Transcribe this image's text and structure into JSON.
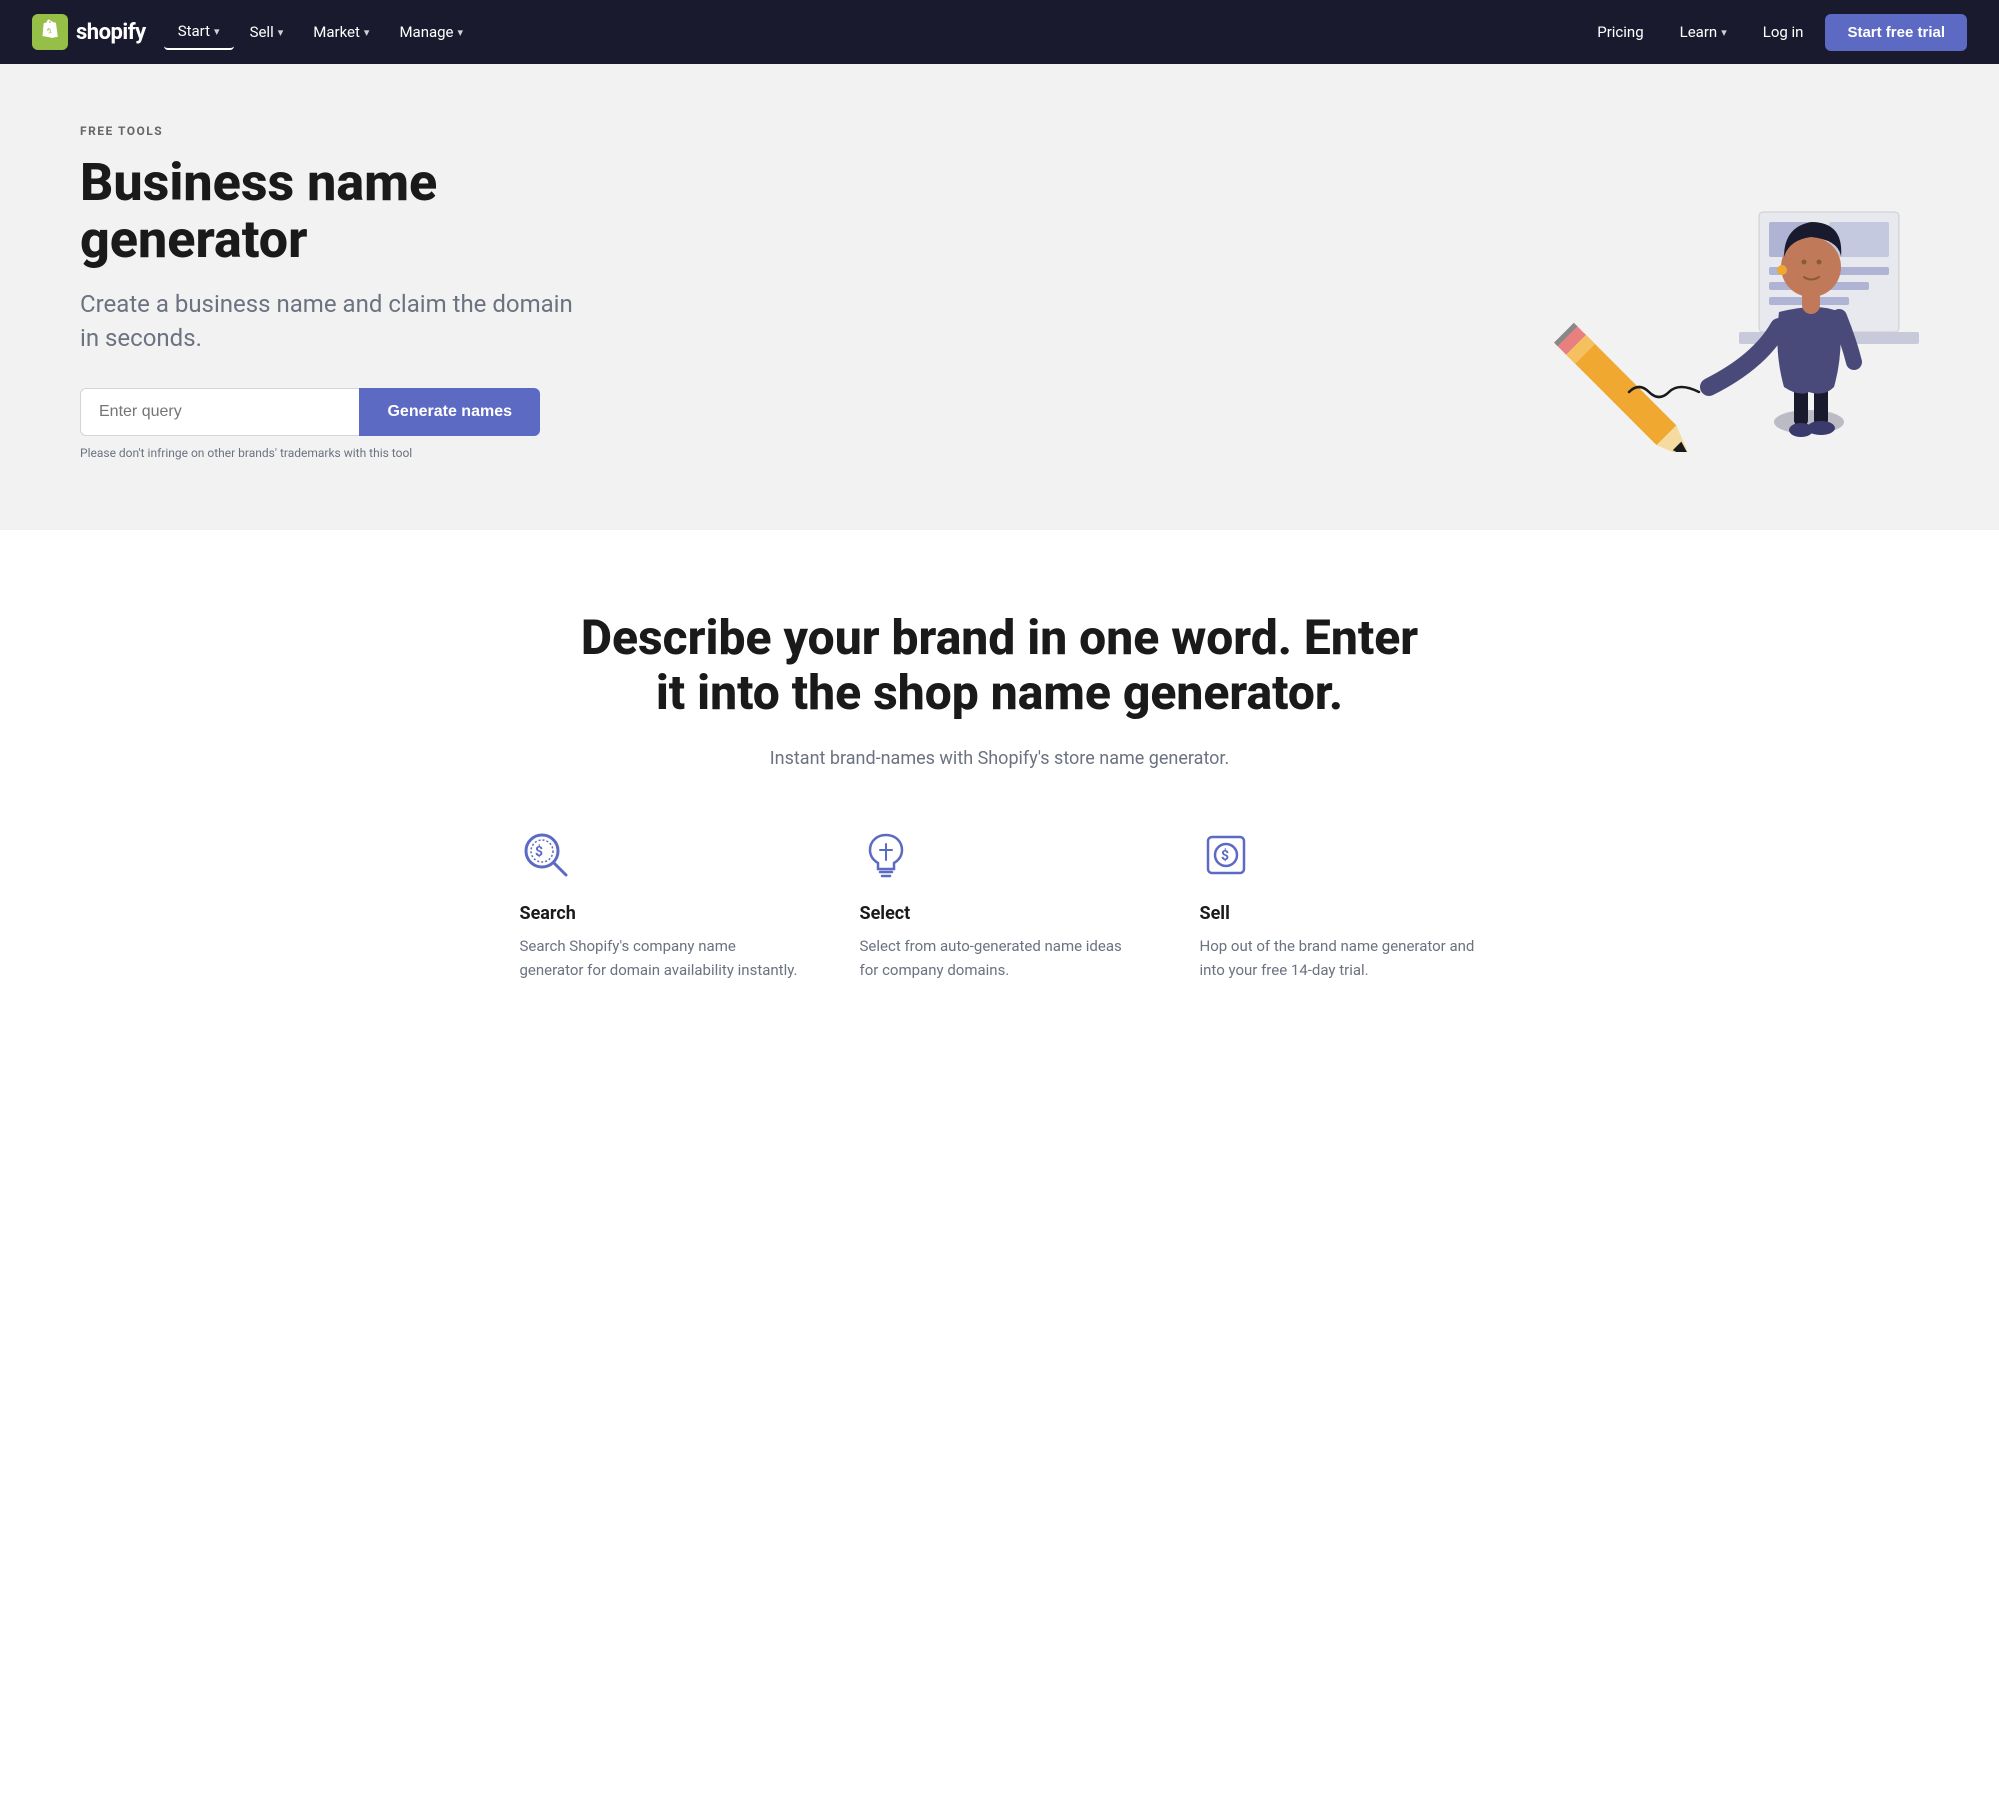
{
  "nav": {
    "logo_text": "shopify",
    "items": [
      {
        "label": "Start",
        "active": true,
        "has_dropdown": true
      },
      {
        "label": "Sell",
        "active": false,
        "has_dropdown": true
      },
      {
        "label": "Market",
        "active": false,
        "has_dropdown": true
      },
      {
        "label": "Manage",
        "active": false,
        "has_dropdown": true
      }
    ],
    "right_items": [
      {
        "label": "Pricing",
        "has_dropdown": false
      },
      {
        "label": "Learn",
        "has_dropdown": true
      },
      {
        "label": "Log in",
        "has_dropdown": false
      }
    ],
    "cta_label": "Start free trial"
  },
  "hero": {
    "label": "FREE TOOLS",
    "title": "Business name generator",
    "subtitle": "Create a business name and claim the domain in seconds.",
    "input_placeholder": "Enter query",
    "button_label": "Generate names",
    "disclaimer": "Please don't infringe on other brands' trademarks with this tool"
  },
  "section": {
    "title": "Describe your brand in one word. Enter it into the shop name generator.",
    "subtitle": "Instant brand-names with Shopify's store name generator."
  },
  "features": [
    {
      "id": "search",
      "title": "Search",
      "desc": "Search Shopify's company name generator for domain availability instantly.",
      "icon": "search"
    },
    {
      "id": "select",
      "title": "Select",
      "desc": "Select from auto-generated name ideas for company domains.",
      "icon": "lightbulb"
    },
    {
      "id": "sell",
      "title": "Sell",
      "desc": "Hop out of the brand name generator and into your free 14-day trial.",
      "icon": "dollar"
    }
  ]
}
